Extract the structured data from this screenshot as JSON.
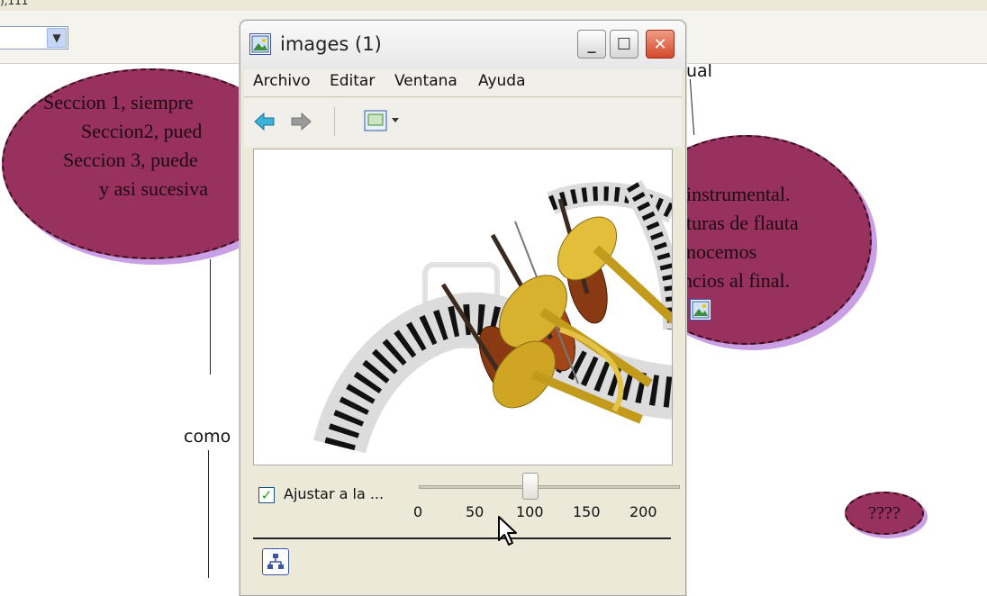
{
  "background": {
    "top_strip_text": "),111",
    "bubbles": [
      {
        "lines": [
          "Seccion 1, siempre",
          "Seccion2, pued",
          "Seccion 3, puede",
          "y asi sucesiva"
        ],
        "color": "#98315e"
      },
      {
        "lines": [
          "instrumental.",
          "turas de flauta",
          "nocemos",
          "ncios al final."
        ],
        "color": "#98315e"
      },
      {
        "lines": [
          "????"
        ],
        "color": "#98315e"
      }
    ],
    "labels": {
      "como": "como",
      "cual": "ual"
    }
  },
  "window": {
    "title": "images (1)",
    "menu": [
      "Archivo",
      "Editar",
      "Ventana",
      "Ayuda"
    ],
    "toolbar": {
      "back_icon": "back-arrow-icon",
      "forward_icon": "forward-arrow-icon",
      "view_icon": "view-mode-icon"
    },
    "fit_checkbox": {
      "label": "Ajustar a la ...",
      "checked": true
    },
    "zoom": {
      "ticks": [
        "0",
        "50",
        "100",
        "150",
        "200"
      ],
      "value": 100
    }
  }
}
